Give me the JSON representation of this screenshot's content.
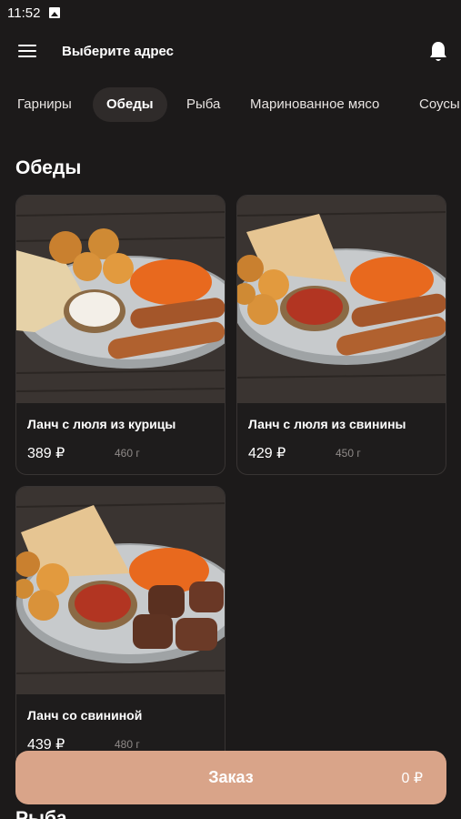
{
  "status": {
    "time": "11:52"
  },
  "header": {
    "address": "Выберите адрес"
  },
  "tabs": [
    {
      "label": "Гарниры"
    },
    {
      "label": "Обеды"
    },
    {
      "label": "Рыба"
    },
    {
      "label": "Маринованное мясо"
    },
    {
      "label": "Соусы"
    }
  ],
  "section": {
    "title": "Обеды",
    "next_title": "Рыба"
  },
  "products": [
    {
      "name": "Ланч с люля из курицы",
      "price": "389 ₽",
      "weight": "460 г",
      "sauce_color": "#f3efe8"
    },
    {
      "name": "Ланч с люля из свинины",
      "price": "429 ₽",
      "weight": "450 г",
      "sauce_color": "#b23522"
    },
    {
      "name": "Ланч со свининой",
      "price": "439 ₽",
      "weight": "480 г",
      "sauce_color": "#b23522"
    }
  ],
  "order": {
    "label": "Заказ",
    "total": "0 ₽"
  },
  "colors": {
    "background": "#1c1a1a",
    "accent": "#d9a489"
  }
}
